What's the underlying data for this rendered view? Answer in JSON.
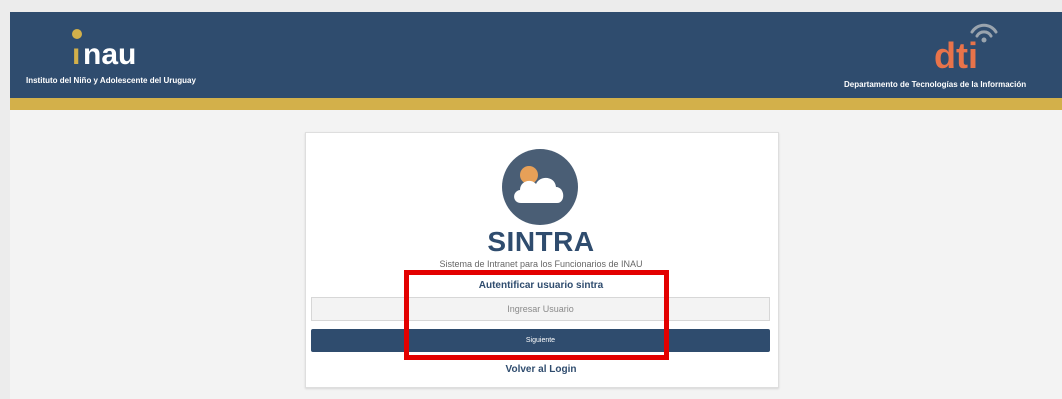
{
  "header": {
    "inau_logo_text": "inau",
    "inau_caption": "Instituto del Niño y Adolescente del Uruguay",
    "dti_logo_text": "dti",
    "dti_caption": "Departamento de Tecnologías de la Información"
  },
  "app": {
    "icon": "cloud-sun-icon",
    "title": "SINTRA",
    "subtitle": "Sistema de Intranet para los Funcionarios de INAU"
  },
  "form": {
    "heading": "Autentificar usuario sintra",
    "username_placeholder": "Ingresar Usuario",
    "username_value": "",
    "next_button_label": "Siguiente",
    "back_link_label": "Volver al Login"
  },
  "colors": {
    "header_bg": "#2f4c6e",
    "gold_bar": "#d3b04a",
    "brand_primary": "#2f4c6e",
    "highlight_border": "#e30000",
    "dti_accent": "#e8734a"
  }
}
